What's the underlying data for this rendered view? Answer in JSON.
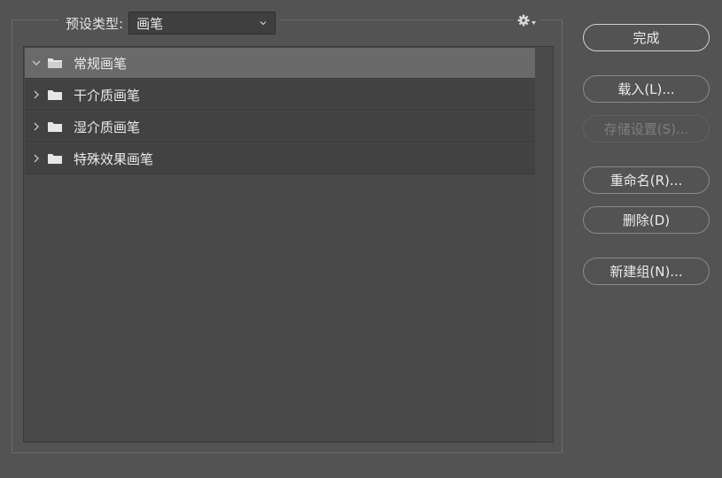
{
  "preset": {
    "label": "预设类型:",
    "selected_value": "画笔"
  },
  "folders": [
    {
      "label": "常规画笔",
      "expanded": true,
      "selected": true
    },
    {
      "label": "干介质画笔",
      "expanded": false,
      "selected": false
    },
    {
      "label": "湿介质画笔",
      "expanded": false,
      "selected": false
    },
    {
      "label": "特殊效果画笔",
      "expanded": false,
      "selected": false
    }
  ],
  "buttons": {
    "done": "完成",
    "load": "载入(L)...",
    "save": "存储设置(S)...",
    "rename": "重命名(R)...",
    "delete": "删除(D)",
    "new_group": "新建组(N)..."
  },
  "icons": {
    "gear": "gear-icon",
    "folder": "folder-icon",
    "chevron_down": "chevron-down-icon",
    "chevron_right": "chevron-right-icon"
  },
  "colors": {
    "background": "#535353",
    "list_background": "#484848",
    "row_background": "#424242",
    "selected_row": "#6a6a6a"
  }
}
